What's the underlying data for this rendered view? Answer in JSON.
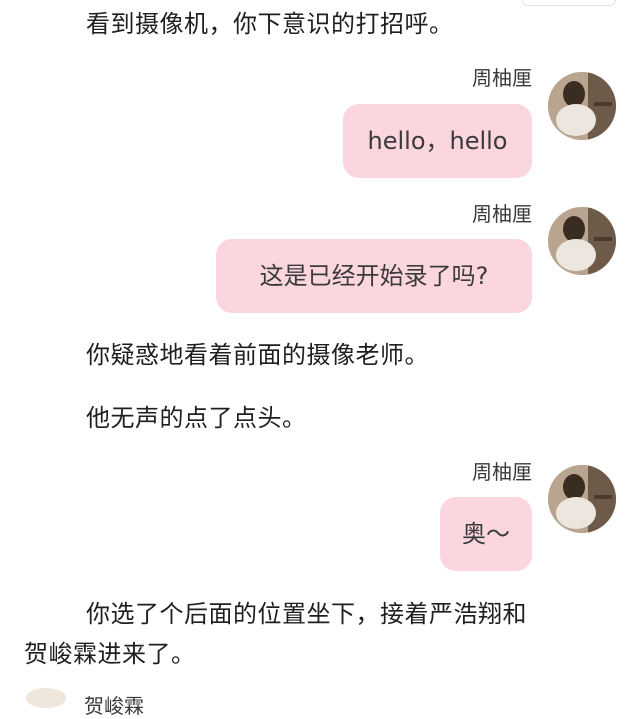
{
  "narration": [
    "看到摄像机，你下意识的打招呼。",
    "你疑惑地看着前面的摄像老师。",
    "他无声的点了点头。",
    "你选了个后面的位置坐下，接着严浩翔和",
    "贺峻霖进来了。"
  ],
  "messages": [
    {
      "sender": "周柚厘",
      "text": "hello，hello",
      "avatar_icon": "avatar-photo-icon"
    },
    {
      "sender": "周柚厘",
      "text": "这是已经开始录了吗?",
      "avatar_icon": "avatar-photo-icon"
    },
    {
      "sender": "周柚厘",
      "text": "奥～",
      "avatar_icon": "avatar-photo-icon"
    }
  ],
  "bottom_partial_name": "贺峻霖",
  "colors": {
    "bubble": "#fbd6df",
    "text": "#1f1f1f",
    "name": "#3a3a3a"
  }
}
